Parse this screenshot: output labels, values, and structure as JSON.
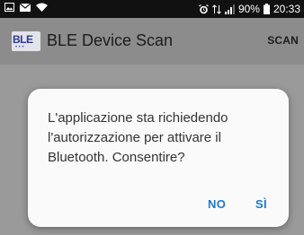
{
  "status_bar": {
    "battery_percent": "90%",
    "time": "20:33",
    "icons": [
      "image-icon",
      "mail-icon",
      "wifi-icon",
      "alarm-icon",
      "network-icon",
      "signal-icon",
      "battery-icon"
    ]
  },
  "app_bar": {
    "logo_text": "BLE",
    "title": "BLE Device Scan",
    "scan_label": "SCAN"
  },
  "dialog": {
    "message": "L'applicazione sta richiedendo l'autorizzazione per attivare il Bluetooth. Consentire?",
    "no_label": "NO",
    "yes_label": "SÌ"
  },
  "colors": {
    "accent": "#1f78c8",
    "status_bar_bg": "#111111",
    "dim_overlay": "#9a9a9a",
    "dialog_bg": "#fafafa"
  }
}
